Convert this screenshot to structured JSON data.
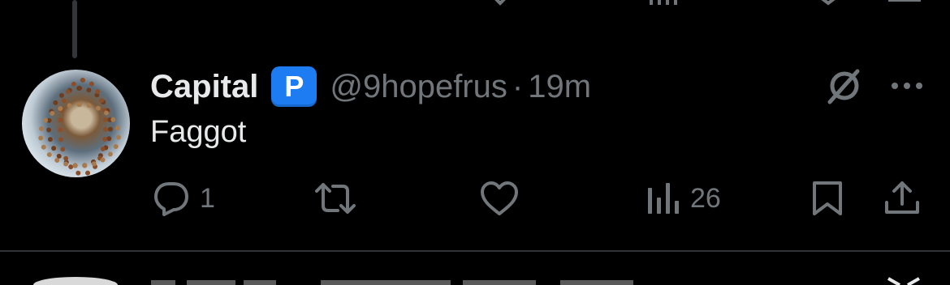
{
  "tweet": {
    "display_name": "Capital",
    "badge_letter": "P",
    "handle": "@9hopefrus",
    "separator": "·",
    "time": "19m",
    "text": "Faggot"
  },
  "actions": {
    "reply_count": "1",
    "retweet_count": "",
    "like_count": "",
    "views_count": "26"
  },
  "icons": {
    "grok": "grok-icon",
    "more": "more-icon",
    "reply": "reply-icon",
    "retweet": "retweet-icon",
    "like": "heart-icon",
    "views": "views-icon",
    "bookmark": "bookmark-icon",
    "share": "share-icon"
  },
  "colors": {
    "background": "#000000",
    "text": "#e7e9ea",
    "secondary": "#71767b",
    "badge": "#1d7cf2",
    "divider": "#2f3336"
  }
}
